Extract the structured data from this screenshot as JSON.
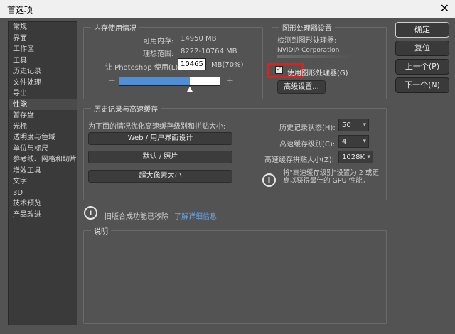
{
  "window": {
    "title": "首选项"
  },
  "sidebar": {
    "items": [
      {
        "label": "常规"
      },
      {
        "label": "界面"
      },
      {
        "label": "工作区"
      },
      {
        "label": "工具"
      },
      {
        "label": "历史记录"
      },
      {
        "label": "文件处理"
      },
      {
        "label": "导出"
      },
      {
        "label": "性能"
      },
      {
        "label": "暂存盘"
      },
      {
        "label": "光标"
      },
      {
        "label": "透明度与色域"
      },
      {
        "label": "单位与标尺"
      },
      {
        "label": "参考线、网格和切片"
      },
      {
        "label": "增效工具"
      },
      {
        "label": "文字"
      },
      {
        "label": "3D"
      },
      {
        "label": "技术预览"
      },
      {
        "label": "产品改进"
      }
    ],
    "selected": "性能"
  },
  "memory": {
    "title": "内存使用情况",
    "available_label": "可用内存:",
    "available_value": "14950 MB",
    "ideal_label": "理想范围:",
    "ideal_value": "8222-10764 MB",
    "let_label": "让 Photoshop 使用(L):",
    "usage_value": "10465",
    "usage_unit": "MB(70%)",
    "usage_fraction": 0.7,
    "minus": "−",
    "plus": "+"
  },
  "gpu": {
    "title": "图形处理器设置",
    "detected_label": "检测到图形处理器:",
    "gpu_name": "NVIDIA Corporation",
    "use_gpu_label": "使用图形处理器(G)",
    "use_gpu_checked": true,
    "advanced_button": "高级设置...",
    "highlight_color": "#e0201b"
  },
  "history_cache": {
    "title": "历史记录与高速缓存",
    "optimize_label": "为下面的情况优化高速缓存级别和拼贴大小:",
    "preset_buttons": [
      "Web / 用户界面设计",
      "默认 / 照片",
      "超大像素大小"
    ],
    "history_states_label": "历史记录状态(H):",
    "history_states_value": "50",
    "cache_levels_label": "高速缓存级别(C):",
    "cache_levels_value": "4",
    "tile_size_label": "高速缓存拼贴大小(Z):",
    "tile_size_value": "1028K",
    "cache_note_line1": "将\"高速缓存级别\"设置为 2 或更",
    "cache_note_line2": "高以获得最佳的 GPU 性能。"
  },
  "notice": {
    "text": "旧版合成功能已移除",
    "link": "了解详细信息"
  },
  "description": {
    "title": "说明"
  },
  "actions": {
    "ok": "确定",
    "reset": "复位",
    "prev": "上一个(P)",
    "next": "下一个(N)"
  },
  "colors": {
    "accent_blue": "#4f8fd8",
    "panel_bg": "#535353",
    "link": "#6aa3e6"
  }
}
